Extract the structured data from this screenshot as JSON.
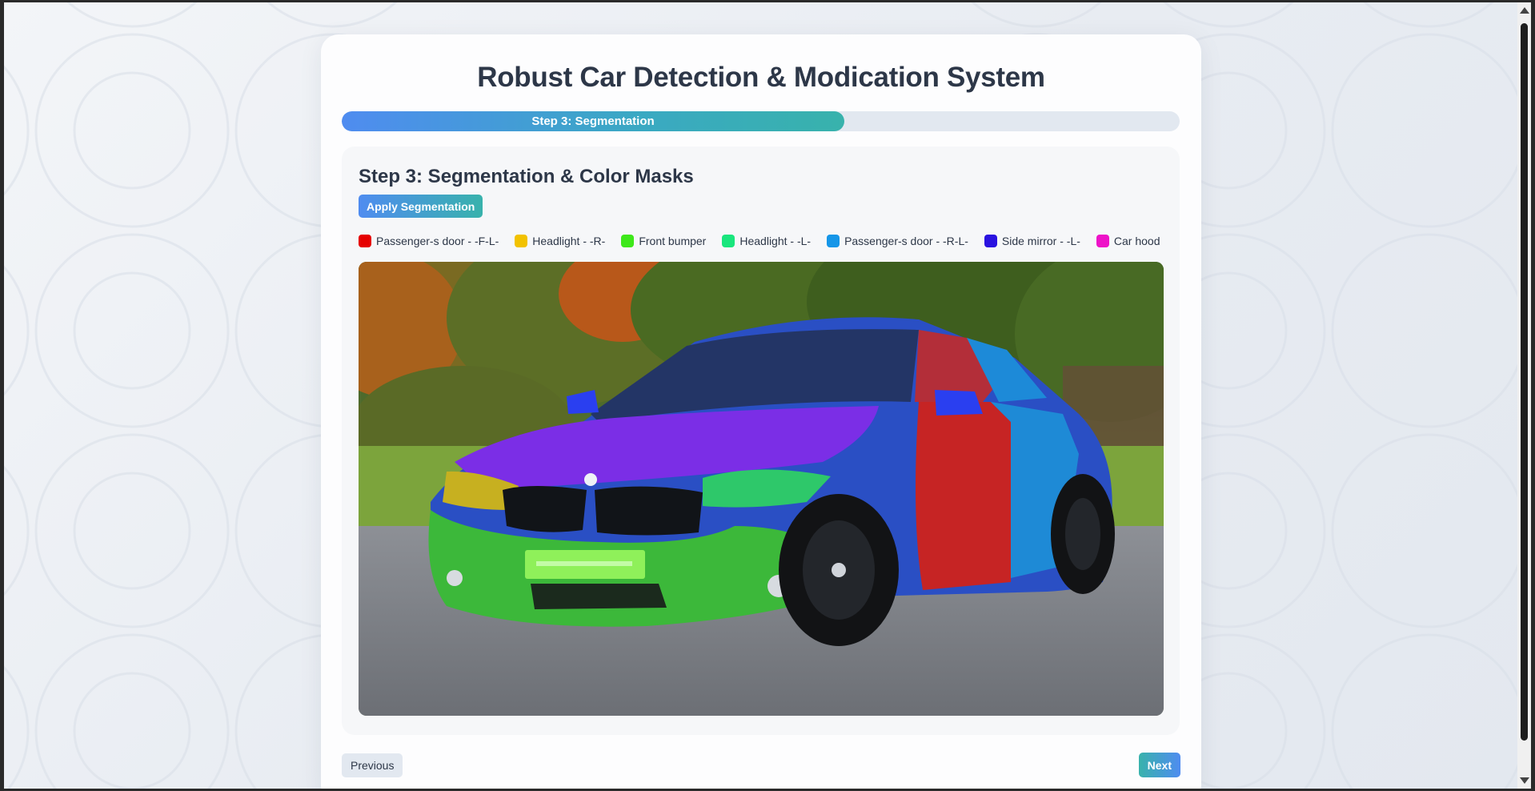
{
  "page": {
    "title": "Robust Car Detection & Modication System"
  },
  "progress": {
    "label": "Step 3: Segmentation",
    "fraction": 0.6
  },
  "step": {
    "heading": "Step 3: Segmentation & Color Masks",
    "apply_button": "Apply Segmentation"
  },
  "legend": [
    {
      "label": "Passenger-s door - -F-L-",
      "color": "#e60000"
    },
    {
      "label": "Headlight - -R-",
      "color": "#f2c200"
    },
    {
      "label": "Front bumper",
      "color": "#3ee81a"
    },
    {
      "label": "Headlight - -L-",
      "color": "#19e67d"
    },
    {
      "label": "Passenger-s door - -R-L-",
      "color": "#1596e8"
    },
    {
      "label": "Side mirror - -L-",
      "color": "#2a12e0"
    },
    {
      "label": "Car hood",
      "color": "#ee12c8"
    }
  ],
  "image": {
    "description_icon": "segmented-car-image"
  },
  "nav": {
    "previous": "Previous",
    "next": "Next"
  },
  "colors": {
    "accent_start": "#4f8cf0",
    "accent_end": "#38b2ac",
    "track": "#e2e8f0",
    "text": "#2d3748"
  }
}
